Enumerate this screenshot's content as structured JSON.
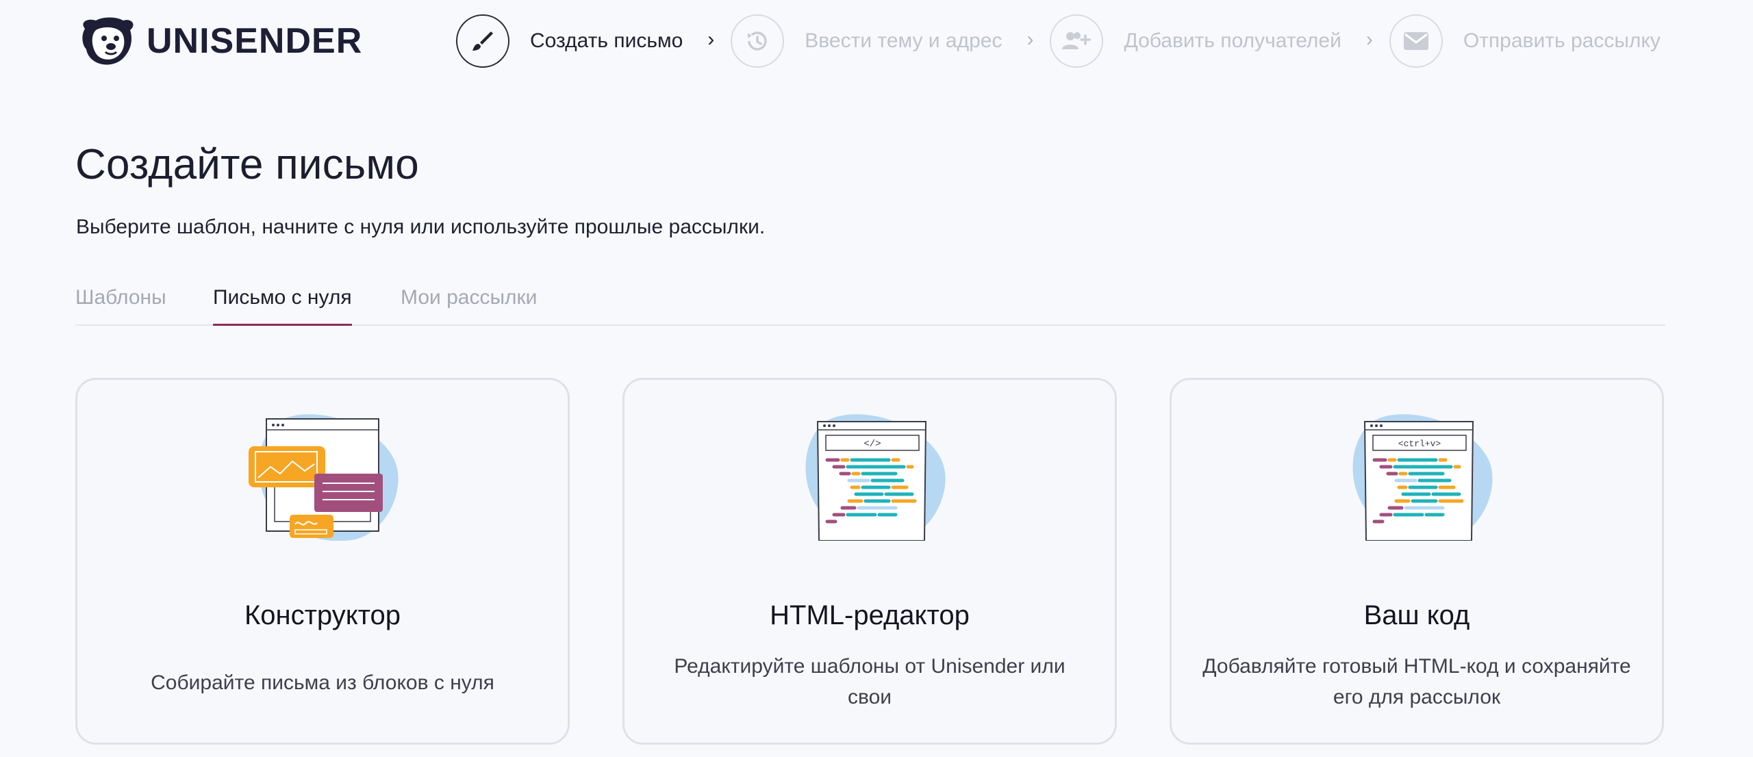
{
  "brand": {
    "name": "UNISENDER",
    "logo_icon": "dog-logo-icon"
  },
  "steps": [
    {
      "label": "Создать письмо",
      "icon": "brush-icon",
      "active": true
    },
    {
      "label": "Ввести тему и адрес",
      "icon": "history-icon",
      "active": false
    },
    {
      "label": "Добавить получателей",
      "icon": "add-users-icon",
      "active": false
    },
    {
      "label": "Отправить рассылку",
      "icon": "envelope-icon",
      "active": false
    }
  ],
  "step_separator": "›",
  "page": {
    "title": "Создайте письмо",
    "subtitle": "Выберите шаблон, начните с нуля или используйте прошлые рассылки."
  },
  "tabs": [
    {
      "label": "Шаблоны",
      "active": false
    },
    {
      "label": "Письмо с нуля",
      "active": true
    },
    {
      "label": "Мои рассылки",
      "active": false
    }
  ],
  "cards": [
    {
      "title": "Конструктор",
      "description": "Собирайте письма из блоков с нуля",
      "illustration": "constructor-illustration"
    },
    {
      "title": "HTML-редактор",
      "description": "Редактируйте шаблоны от Unisender или свои",
      "code_label": "</>",
      "illustration": "html-editor-illustration"
    },
    {
      "title": "Ваш код",
      "description": "Добавляйте готовый HTML-код и сохраняйте его для рассылок",
      "code_label": "<ctrl+v>",
      "illustration": "paste-code-illustration"
    }
  ],
  "colors": {
    "accent": "#8b2c5f",
    "text_dark": "#1c1d2e",
    "text_muted": "#a6a8b2",
    "blob_blue": "#b6d8f2",
    "orange": "#f6a623",
    "plum": "#a24f7e",
    "teal": "#1fb3b9"
  }
}
